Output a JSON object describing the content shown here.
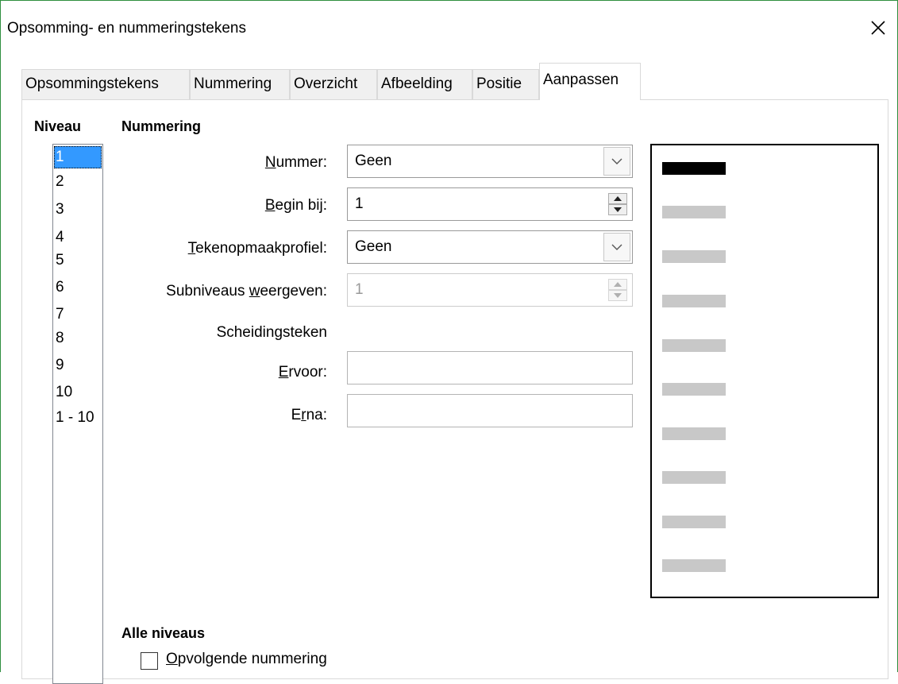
{
  "window": {
    "title": "Opsomming- en nummeringstekens",
    "close_glyph": "✕"
  },
  "tabs": [
    {
      "label": "Opsommingstekens",
      "active": false
    },
    {
      "label": "Nummering",
      "active": false
    },
    {
      "label": "Overzicht",
      "active": false
    },
    {
      "label": "Afbeelding",
      "active": false
    },
    {
      "label": "Positie",
      "active": false
    },
    {
      "label": "Aanpassen",
      "active": true
    }
  ],
  "level": {
    "heading": "Niveau",
    "items": [
      "1",
      "2",
      "3",
      "4",
      "5",
      "6",
      "7",
      "8",
      "9",
      "10",
      "1 - 10"
    ],
    "selected": "1"
  },
  "numbering": {
    "heading": "Nummering",
    "number": {
      "label_u": "N",
      "label_rest": "ummer:",
      "value": "Geen"
    },
    "start_at": {
      "label_u": "B",
      "label_rest": "egin bij:",
      "value": "1"
    },
    "char_style": {
      "label_u": "T",
      "label_rest": "ekenopmaakprofiel:",
      "value": "Geen"
    },
    "sublevels": {
      "label_pre": "Subniveaus ",
      "label_u": "w",
      "label_rest": "eergeven:",
      "value": "1",
      "disabled": true
    },
    "separator_heading": "Scheidingsteken",
    "before": {
      "label_u": "E",
      "label_rest": "rvoor:",
      "value": ""
    },
    "after": {
      "label_pre": "E",
      "label_u": "r",
      "label_rest": "na:",
      "value": ""
    }
  },
  "preview": {
    "bars": 10,
    "active_bar_index": 0,
    "colors": {
      "active": "#000000",
      "inactive": "#c8c8c8"
    }
  },
  "all_levels": {
    "heading": "Alle niveaus",
    "consecutive": {
      "label_u": "O",
      "label_rest": "pvolgende nummering",
      "checked": false
    }
  },
  "colors": {
    "selection": "#3399ff",
    "window_border": "#2f8f3f"
  }
}
